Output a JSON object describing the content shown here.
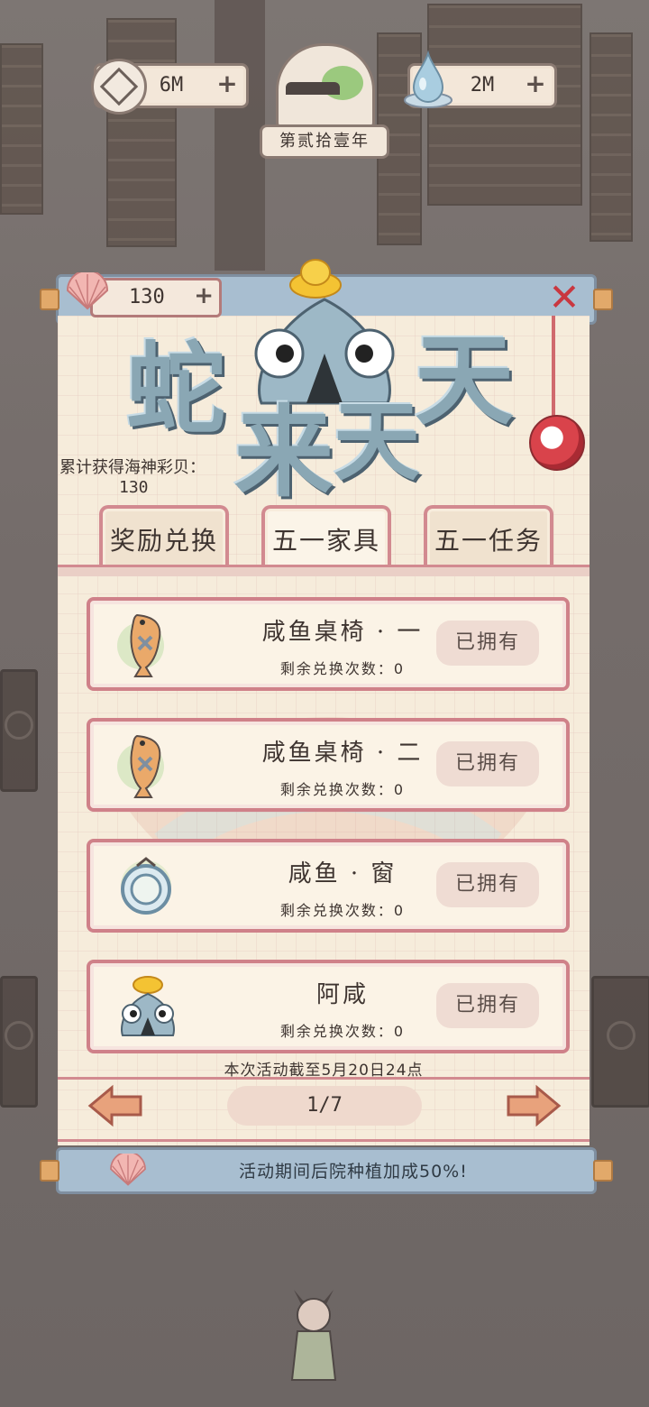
{
  "top_bar": {
    "coins": {
      "value": "6M",
      "plus": "+"
    },
    "year_badge": {
      "label": "第贰拾壹年"
    },
    "water": {
      "value": "2M",
      "plus": "+"
    }
  },
  "event_panel": {
    "shell_counter": {
      "value": "130",
      "plus": "+"
    },
    "close_icon": "✕",
    "title_chars": [
      "蛇",
      "来",
      "天",
      "天"
    ],
    "total_shells_label": "累计获得海神彩贝：",
    "total_shells_value": "130",
    "tabs": [
      {
        "label": "奖励兑换",
        "active": false
      },
      {
        "label": "五一家具",
        "active": true
      },
      {
        "label": "五一任务",
        "active": false
      }
    ],
    "items": [
      {
        "name": "咸鱼桌椅 · 一",
        "remaining": "剩余兑换次数：0",
        "status": "已拥有",
        "icon": "salted-fish-icon"
      },
      {
        "name": "咸鱼桌椅 · 二",
        "remaining": "剩余兑换次数：0",
        "status": "已拥有",
        "icon": "salted-fish-icon"
      },
      {
        "name": "咸鱼 · 窗",
        "remaining": "剩余兑换次数：0",
        "status": "已拥有",
        "icon": "round-window-icon"
      },
      {
        "name": "阿咸",
        "remaining": "剩余兑换次数：0",
        "status": "已拥有",
        "icon": "fish-mascot-icon"
      }
    ],
    "deadline": "本次活动截至5月20日24点",
    "page": "1/7",
    "bonus_text": "活动期间后院种植加成50%!"
  },
  "colors": {
    "accent_pink": "#cf8189",
    "panel_bg": "#f6ecdb",
    "scroll_blue": "#a8bed0"
  }
}
